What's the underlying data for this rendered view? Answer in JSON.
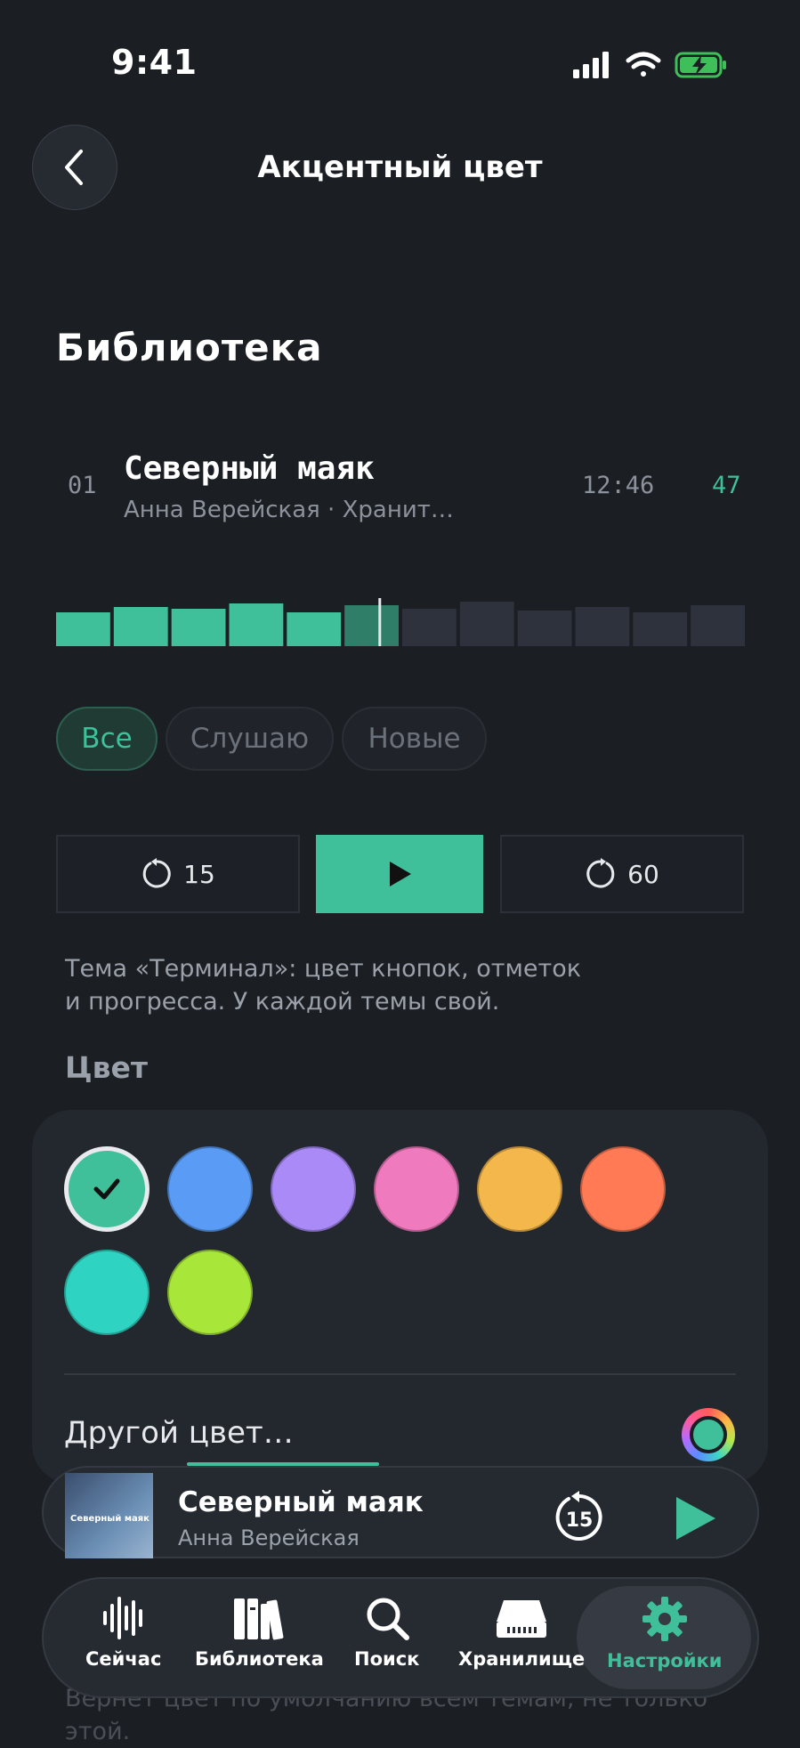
{
  "status_bar": {
    "time": "9:41"
  },
  "header": {
    "title": "Акцентный цвет"
  },
  "section": {
    "title": "Библиотека"
  },
  "track": {
    "number": "01",
    "title": "Северный маяк",
    "subtitle": "Анна Верейская · Хранит…",
    "duration": "12:46",
    "count": "47"
  },
  "waveform": {
    "progress_fraction": 0.47
  },
  "chips": {
    "all": "Все",
    "listening": "Слушаю",
    "new": "Новые"
  },
  "transport": {
    "back_seconds": "15",
    "forward_seconds": "60"
  },
  "description": {
    "line1": "Тема «Терминал»: цвет кнопок, отметок",
    "line2": "и прогресса. У каждой темы свой."
  },
  "color_section": {
    "label": "Цвет",
    "other_color": "Другой цвет…"
  },
  "swatches": [
    "#3fbf9a",
    "#5a9cf5",
    "#a98af7",
    "#f07abe",
    "#f4b74b",
    "#ff7a55",
    "#2fd3c2",
    "#a8e63a"
  ],
  "selected_swatch": "#3fbf9a",
  "reset_note": {
    "line1": "Вернёт цвет по умолчанию всем темам, не только",
    "line2": "этой."
  },
  "mini_player": {
    "title": "Северный маяк",
    "artist": "Анна Верейская",
    "cover_title": "Северный маяк",
    "skip_seconds": "15"
  },
  "tabs": [
    {
      "label": "Сейчас",
      "icon": "waveform-icon"
    },
    {
      "label": "Библиотека",
      "icon": "books-icon"
    },
    {
      "label": "Поиск",
      "icon": "search-icon"
    },
    {
      "label": "Хранилище",
      "icon": "storage-icon"
    },
    {
      "label": "Настройки",
      "icon": "gear-icon",
      "active": true
    }
  ],
  "accent_color": "#3fbf9a"
}
